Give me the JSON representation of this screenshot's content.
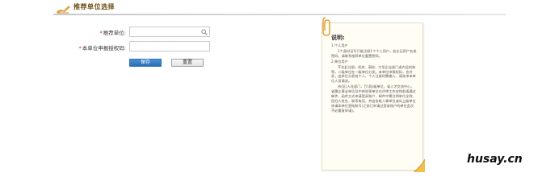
{
  "header": {
    "title": "推荐单位选择"
  },
  "form": {
    "unit_label": "推荐单位:",
    "code_label": "本单位申报授权码:",
    "unit_value": "",
    "code_value": "",
    "save_label": "保存",
    "reset_label": "重置"
  },
  "note": {
    "title": "说明:",
    "items": [
      "1.个人用户",
      "1个身份证号只能注册1个个人用户。若忘记用户名或密码，请联系推荐单位重置密码。",
      "2.单位用户",
      "不在此注册。机关、高校、大型企业部门或内设机构等，二级单位在一级单位分发。本单位申报权码，也许发，由单位分发给个人，个人注册时需输入，请先申本单位人员填选。",
      "市(区)人社部门，厅(局)级单位，省人才交流中心，省属企事业单位及中央驻鄂单位在评审工作安排前请通过邮件、函件方式申请登录账户，邮件中需注明单位全称、经办人姓名、联系电话，并由各级人事单位或向上级单位申请本单位登陆账号(之前已申请过登录账户的单位此次不必重复申请)。"
    ]
  },
  "watermark": "husay.cn"
}
